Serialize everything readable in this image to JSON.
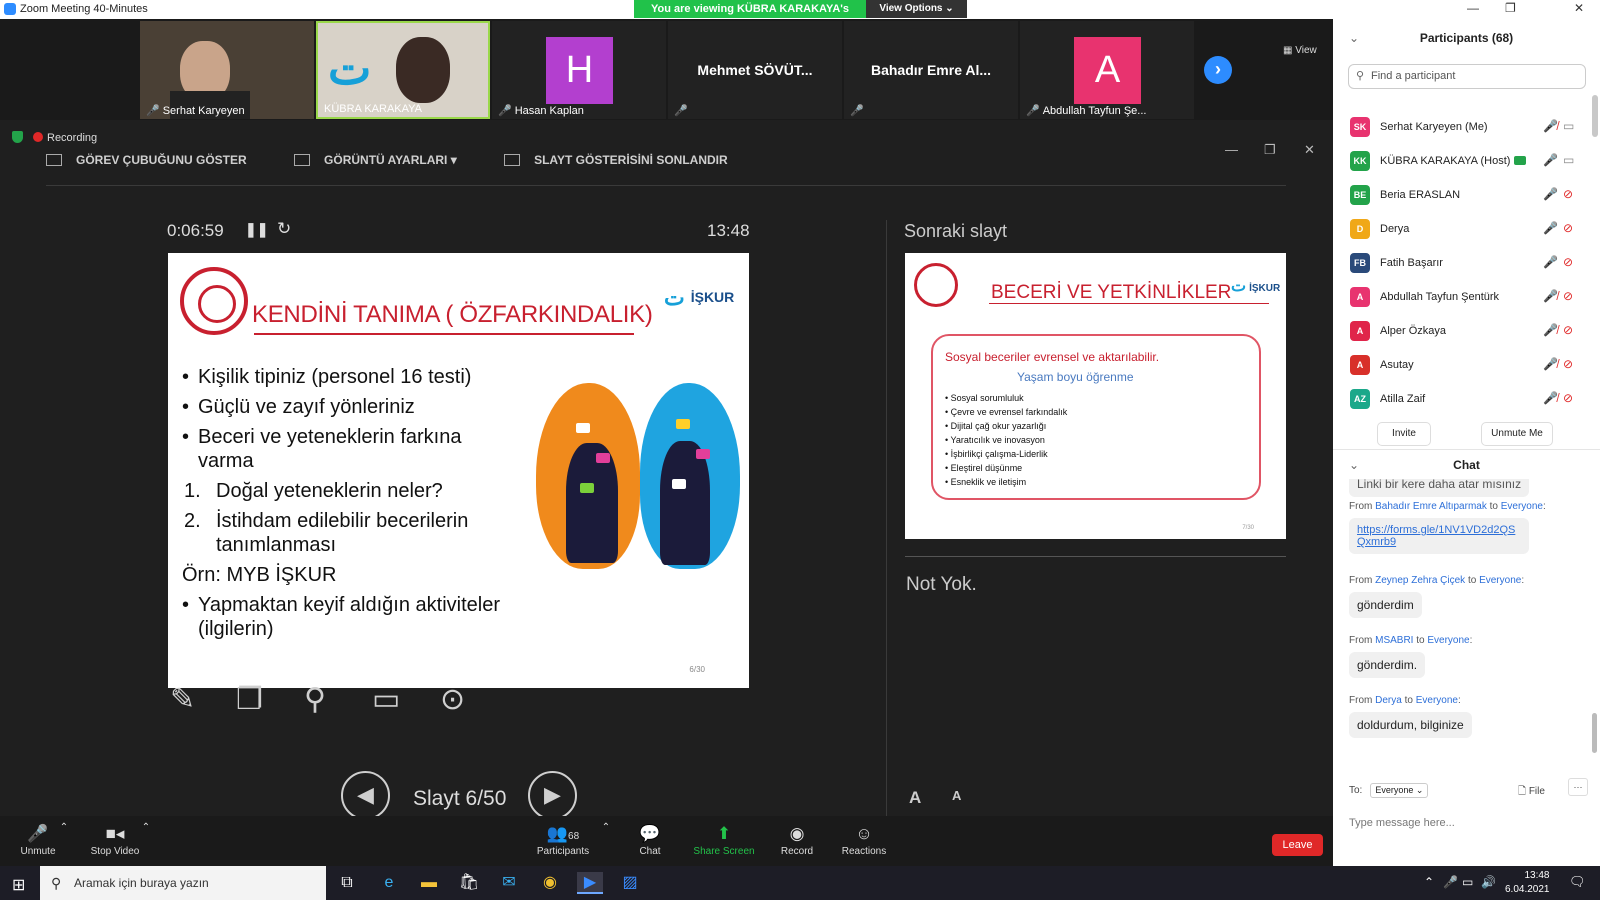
{
  "window": {
    "title": "Zoom Meeting 40-Minutes",
    "viewing_banner": "You are viewing KÜBRA KARAKAYA's screen",
    "view_options": "View Options ⌄",
    "minimize": "—",
    "restore": "❐",
    "close": "✕"
  },
  "gallery": {
    "tiles": [
      {
        "name": "Serhat Karyeyen",
        "type": "video"
      },
      {
        "name": "KÜBRA KARAKAYA",
        "type": "video"
      },
      {
        "name": "Hasan Kaplan",
        "type": "avatar",
        "letter": "H",
        "color": "#b33fcf"
      },
      {
        "name": "",
        "display": "Mehmet SÖVÜT...",
        "type": "name"
      },
      {
        "name": "",
        "display": "Bahadır Emre Al...",
        "type": "name"
      },
      {
        "name": "Abdullah Tayfun Şe...",
        "type": "avatar",
        "letter": "A",
        "color": "#e8336f"
      }
    ],
    "view_label": "View",
    "next_icon": "›"
  },
  "presenter": {
    "recording": "Recording",
    "toolbar": {
      "taskbar": "GÖREV ÇUBUĞUNU GÖSTER",
      "display": "GÖRÜNTÜ AYARLARI ▾",
      "end_show": "SLAYT GÖSTERİSİNİ SONLANDIR"
    },
    "timer": "0:06:59",
    "clock": "13:48",
    "pause": "❚❚",
    "restart": "↻",
    "slide_label": "Slayt 6/50",
    "progress": 0.12,
    "next_header": "Sonraki slayt",
    "notes": "Not Yok.",
    "font_up": "A",
    "font_down": "A"
  },
  "slide": {
    "title": "KENDİNİ TANIMA ( ÖZFARKINDALIK)",
    "logo": "İŞKUR",
    "bullets": [
      "Kişilik tipiniz (personel 16 testi)",
      "Güçlü ve zayıf yönleriniz",
      "Beceri ve yeteneklerin farkına varma"
    ],
    "numbered": [
      {
        "num": "1.",
        "text": "Doğal yeteneklerin neler?"
      },
      {
        "num": "2.",
        "text": "İstihdam edilebilir becerilerin tanımlanması"
      }
    ],
    "example": "Örn: MYB İŞKUR",
    "last_bullet": "Yapmaktan keyif aldığın aktiviteler (ilgilerin)",
    "number": "6/30"
  },
  "next_slide": {
    "title": "BECERİ VE YETKİNLİKLER",
    "logo": "İŞKUR",
    "line1": "Sosyal beceriler evrensel ve aktarılabilir.",
    "line2": "Yaşam boyu öğrenme",
    "items": [
      "Sosyal sorumluluk",
      "Çevre ve evrensel farkındalık",
      "Dijital çağ okur yazarlığı",
      "Yaratıcılık ve inovasyon",
      "İşbirlikçi çalışma-Liderlik",
      "Eleştirel düşünme",
      "Esneklik ve iletişim"
    ],
    "number": "7/30"
  },
  "meeting_toolbar": {
    "unmute": "Unmute",
    "stop_video": "Stop Video",
    "participants": "Participants",
    "participants_count": "68",
    "chat": "Chat",
    "share_screen": "Share Screen",
    "record": "Record",
    "reactions": "Reactions",
    "leave": "Leave"
  },
  "participants": {
    "header": "Participants (68)",
    "search_placeholder": "Find a participant",
    "list": [
      {
        "initials": "SK",
        "name": "Serhat Karyeyen (Me)",
        "color": "#e8336f",
        "mic": "muted",
        "cam": "on"
      },
      {
        "initials": "KK",
        "name": "KÜBRA KARAKAYA (Host)",
        "color": "#23a34a",
        "mic": "on",
        "cam": "on",
        "sharing": true
      },
      {
        "initials": "BE",
        "name": "Beria ERASLAN",
        "color": "#23a34a",
        "mic": "on",
        "cam": "off"
      },
      {
        "initials": "D",
        "name": "Derya",
        "color": "#f0a818",
        "mic": "on",
        "cam": "off"
      },
      {
        "initials": "FB",
        "name": "Fatih Başarır",
        "color": "#2a4a7a",
        "mic": "on",
        "cam": "off"
      },
      {
        "initials": "A",
        "name": "Abdullah Tayfun Şentürk",
        "color": "#e8336f",
        "mic": "muted",
        "cam": "off"
      },
      {
        "initials": "A",
        "name": "Alper Özkaya",
        "color": "#e0254a",
        "mic": "muted",
        "cam": "off"
      },
      {
        "initials": "A",
        "name": "Asutay",
        "color": "#d8302a",
        "mic": "muted",
        "cam": "off"
      },
      {
        "initials": "AZ",
        "name": "Atilla Zaif",
        "color": "#1ba88a",
        "mic": "muted",
        "cam": "off"
      }
    ],
    "invite": "Invite",
    "unmute_me": "Unmute Me"
  },
  "chat": {
    "header": "Chat",
    "partial": "Linki bir kere daha atar mısınız",
    "messages": [
      {
        "from": "Bahadır Emre Altıparmak",
        "to": "Everyone",
        "text": "https://forms.gle/1NV1VD2d2QSQxmrb9",
        "link": true
      },
      {
        "from": "Zeynep Zehra Çiçek",
        "to": "Everyone",
        "text": "gönderdim"
      },
      {
        "from": "MSABRI",
        "to": "Everyone",
        "text": "gönderdim."
      },
      {
        "from": "Derya",
        "to": "Everyone",
        "text": "doldurdum, bilginize"
      }
    ],
    "from_word": "From",
    "to_word": "to",
    "to_label": "To:",
    "to_value": "Everyone ⌄",
    "file": "File",
    "more": "···",
    "placeholder": "Type message here..."
  },
  "taskbar": {
    "search": "Aramak için buraya yazın",
    "time": "13:48",
    "date": "6.04.2021"
  }
}
